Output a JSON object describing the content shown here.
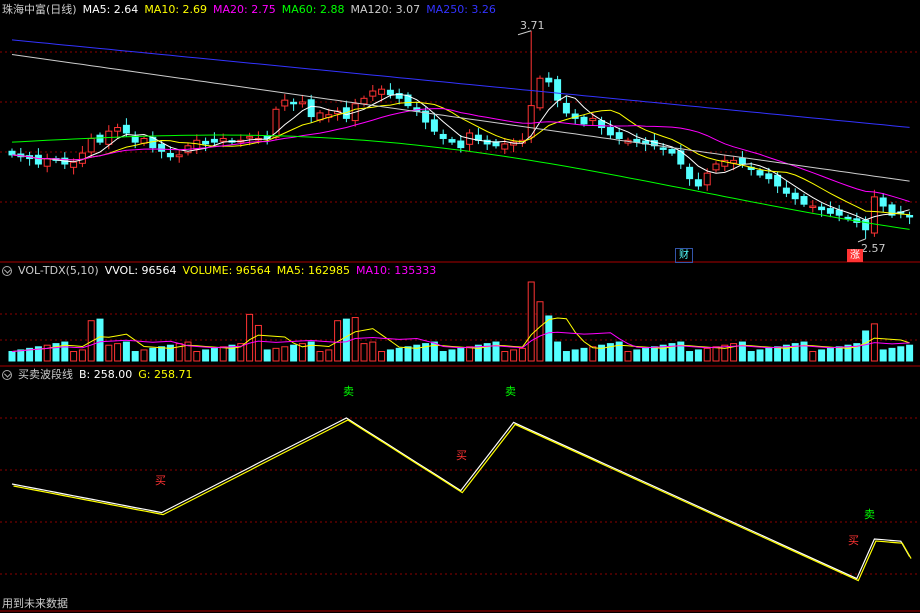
{
  "main": {
    "title": "珠海中富(日线)",
    "indicators": [
      {
        "label": "MA5: 2.64",
        "color": "#ffffff"
      },
      {
        "label": "MA10: 2.69",
        "color": "#ffff00"
      },
      {
        "label": "MA20: 2.75",
        "color": "#ff00ff"
      },
      {
        "label": "MA60: 2.88",
        "color": "#00ff00"
      },
      {
        "label": "MA120: 3.07",
        "color": "#cccccc"
      },
      {
        "label": "MA250: 3.26",
        "color": "#3333ff"
      }
    ],
    "high_label": "3.71",
    "low_label": "2.57",
    "badge_cai": "财",
    "badge_zhang": "涨"
  },
  "volume": {
    "title": "VOL-TDX(5,10)",
    "indicators": [
      {
        "label": "VVOL: 96564",
        "color": "#ffffff"
      },
      {
        "label": "VOLUME: 96564",
        "color": "#ffff00"
      },
      {
        "label": "MA5: 162985",
        "color": "#ffff00"
      },
      {
        "label": "MA10: 135333",
        "color": "#ff00ff"
      }
    ]
  },
  "wave": {
    "title": "买卖波段线",
    "indicators": [
      {
        "label": "B: 258.00",
        "color": "#ffffff"
      },
      {
        "label": "G: 258.71",
        "color": "#ffff00"
      }
    ],
    "buy_label": "买",
    "sell_label": "卖"
  },
  "footer": "用到未来数据",
  "colors": {
    "up": "#ff3333",
    "down": "#54ffff",
    "grid": "#8b0000"
  },
  "chart_data": [
    {
      "type": "candlestick",
      "title": "珠海中富(日线)",
      "series": [
        {
          "name": "MA5",
          "value": 2.64
        },
        {
          "name": "MA10",
          "value": 2.69
        },
        {
          "name": "MA20",
          "value": 2.75
        },
        {
          "name": "MA60",
          "value": 2.88
        },
        {
          "name": "MA120",
          "value": 3.07
        },
        {
          "name": "MA250",
          "value": 3.26
        }
      ],
      "annotations": {
        "high": 3.71,
        "low": 2.57
      },
      "close": [
        3.03,
        3.02,
        3.01,
        2.98,
        3.01,
        3.0,
        2.98,
        2.99,
        3.04,
        3.12,
        3.1,
        3.16,
        3.18,
        3.15,
        3.1,
        3.12,
        3.07,
        3.05,
        3.02,
        3.03,
        3.08,
        3.11,
        3.09,
        3.1,
        3.12,
        3.1,
        3.11,
        3.13,
        3.12,
        3.12,
        3.28,
        3.33,
        3.31,
        3.32,
        3.24,
        3.26,
        3.25,
        3.27,
        3.23,
        3.31,
        3.34,
        3.38,
        3.39,
        3.36,
        3.34,
        3.3,
        3.27,
        3.21,
        3.16,
        3.12,
        3.1,
        3.07,
        3.15,
        3.11,
        3.09,
        3.08,
        3.09,
        3.1,
        3.11,
        3.3,
        3.45,
        3.43,
        3.33,
        3.26,
        3.23,
        3.2,
        3.23,
        3.18,
        3.14,
        3.12,
        3.11,
        3.1,
        3.09,
        3.08,
        3.06,
        3.04,
        2.98,
        2.9,
        2.86,
        2.93,
        2.98,
        3.0,
        3.0,
        2.98,
        2.95,
        2.92,
        2.9,
        2.86,
        2.82,
        2.79,
        2.76,
        2.75,
        2.73,
        2.71,
        2.7,
        2.68,
        2.66,
        2.62,
        2.8,
        2.75,
        2.7,
        2.71,
        2.69
      ]
    },
    {
      "type": "bar",
      "title": "VOL-TDX(5,10)",
      "series": [
        {
          "name": "VVOL",
          "value": 96564
        },
        {
          "name": "VOLUME",
          "value": 96564
        },
        {
          "name": "MA5",
          "value": 162985
        },
        {
          "name": "MA10",
          "value": 135333
        }
      ]
    },
    {
      "type": "line",
      "title": "买卖波段线",
      "series": [
        {
          "name": "B",
          "value": 258.0
        },
        {
          "name": "G",
          "value": 258.71
        }
      ],
      "signals": [
        {
          "label": "买",
          "index": 17
        },
        {
          "label": "卖",
          "index": 38
        },
        {
          "label": "买",
          "index": 51
        },
        {
          "label": "卖",
          "index": 57
        },
        {
          "label": "买",
          "index": 97
        },
        {
          "label": "卖",
          "index": 101
        }
      ]
    }
  ]
}
